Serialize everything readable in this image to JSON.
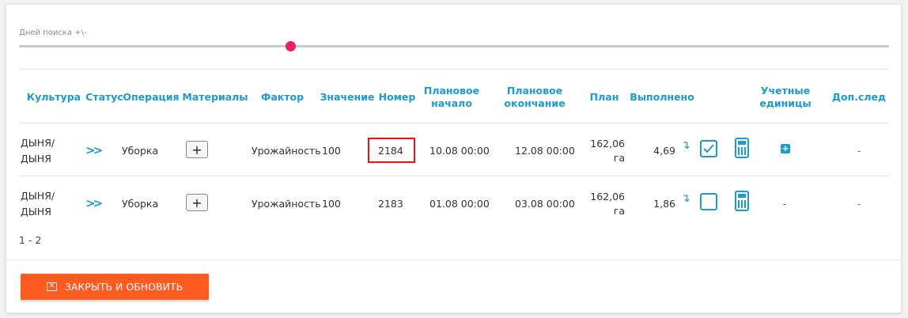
{
  "slider": {
    "label": "Дней поиска +\\-",
    "value_fraction": 0.31
  },
  "columns": [
    {
      "key": "culture",
      "label": "Культура"
    },
    {
      "key": "status",
      "label": "Статус"
    },
    {
      "key": "operation",
      "label": "Операция"
    },
    {
      "key": "materials",
      "label": "Материалы"
    },
    {
      "key": "factor",
      "label": "Фактор"
    },
    {
      "key": "value",
      "label": "Значение"
    },
    {
      "key": "number",
      "label": "Номер"
    },
    {
      "key": "plan_start",
      "label": "Плановое начало"
    },
    {
      "key": "plan_end",
      "label": "Плановое окончание"
    },
    {
      "key": "plan",
      "label": "План"
    },
    {
      "key": "done",
      "label": "Выполнено"
    },
    {
      "key": "units",
      "label": "Учетные единицы"
    },
    {
      "key": "extra",
      "label": "Доп.след"
    }
  ],
  "rows": [
    {
      "culture": "ДЫНЯ/ ДЫНЯ",
      "status": ">>",
      "operation": "Уборка",
      "materials": "+",
      "factor": "Урожайность",
      "value": "100",
      "number": "2184",
      "number_highlighted": true,
      "plan_start": "10.08 00:00",
      "plan_end": "12.08 00:00",
      "plan": "162,06 га",
      "done": "4,69",
      "checked": true,
      "units": "+",
      "extra": "-"
    },
    {
      "culture": "ДЫНЯ/ ДЫНЯ",
      "status": ">>",
      "operation": "Уборка",
      "materials": "+",
      "factor": "Урожайность",
      "value": "100",
      "number": "2183",
      "number_highlighted": false,
      "plan_start": "01.08 00:00",
      "plan_end": "03.08 00:00",
      "plan": "162,06 га",
      "done": "1,86",
      "checked": false,
      "units": "-",
      "extra": "-"
    }
  ],
  "pager": "1 - 2",
  "footer": {
    "close_label": "ЗАКРЫТЬ И ОБНОВИТЬ"
  },
  "colors": {
    "accent": "#1a9bd7",
    "button": "#ff5a1f",
    "slider_thumb": "#e91e63",
    "highlight": "#ee1111"
  }
}
